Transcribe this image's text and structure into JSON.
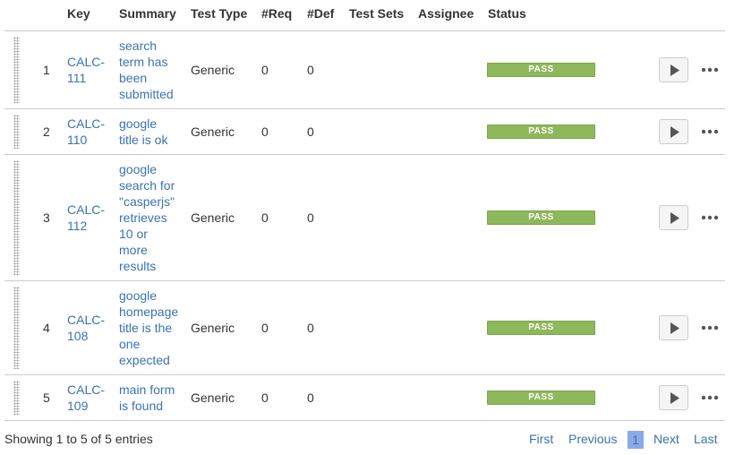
{
  "columns": {
    "key": "Key",
    "summary": "Summary",
    "test_type": "Test Type",
    "req": "#Req",
    "def": "#Def",
    "test_sets": "Test Sets",
    "assignee": "Assignee",
    "status": "Status"
  },
  "rows": [
    {
      "num": "1",
      "key_lines": [
        "CALC-",
        "111"
      ],
      "summary_lines": [
        "search",
        "term has",
        "been",
        "submitted"
      ],
      "type": "Generic",
      "req": "0",
      "def": "0",
      "status": "PASS"
    },
    {
      "num": "2",
      "key_lines": [
        "CALC-",
        "110"
      ],
      "summary_lines": [
        "google",
        "title is ok"
      ],
      "type": "Generic",
      "req": "0",
      "def": "0",
      "status": "PASS"
    },
    {
      "num": "3",
      "key_lines": [
        "CALC-",
        "112"
      ],
      "summary_lines": [
        "google",
        "search for",
        "\"casperjs\"",
        "retrieves",
        "10 or",
        "more",
        "results"
      ],
      "type": "Generic",
      "req": "0",
      "def": "0",
      "status": "PASS"
    },
    {
      "num": "4",
      "key_lines": [
        "CALC-",
        "108"
      ],
      "summary_lines": [
        "google",
        "homepage",
        "title is the",
        "one",
        "expected"
      ],
      "type": "Generic",
      "req": "0",
      "def": "0",
      "status": "PASS"
    },
    {
      "num": "5",
      "key_lines": [
        "CALC-",
        "109"
      ],
      "summary_lines": [
        "main form",
        "is found"
      ],
      "type": "Generic",
      "req": "0",
      "def": "0",
      "status": "PASS"
    }
  ],
  "footer": {
    "info": "Showing 1 to 5 of 5 entries"
  },
  "pagination": {
    "first": "First",
    "previous": "Previous",
    "current": "1",
    "next": "Next",
    "last": "Last"
  },
  "icons": {
    "run": "play-icon",
    "more": "more-options-icon",
    "drag": "drag-handle-icon"
  },
  "colors": {
    "link": "#3b73af",
    "pass": "#8eb85c",
    "current_page": "#8aa9e6"
  }
}
